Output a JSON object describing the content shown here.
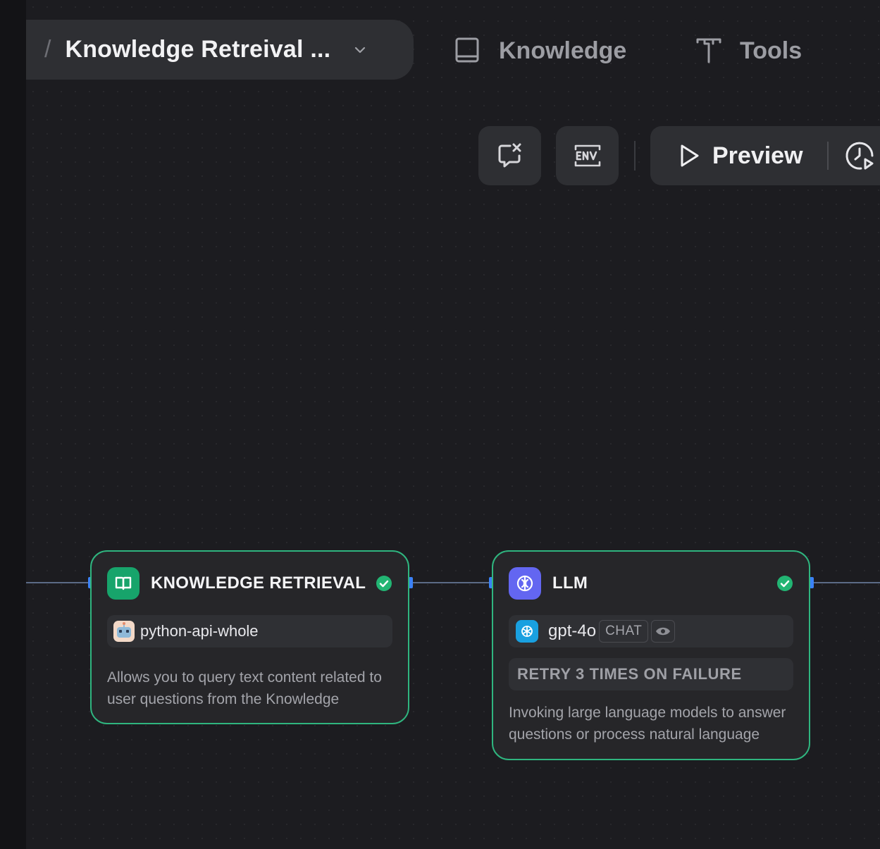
{
  "header": {
    "separator": "/",
    "app_title": "Knowledge Retreival ...",
    "nav": [
      {
        "label": "Knowledge",
        "icon": "book-icon"
      },
      {
        "label": "Tools",
        "icon": "tools-icon"
      }
    ]
  },
  "toolbar": {
    "buttons": [
      {
        "icon": "clear-conversation-icon"
      },
      {
        "icon": "env-icon"
      }
    ],
    "preview_label": "Preview",
    "history_icon": "run-history-icon"
  },
  "nodes": [
    {
      "id": "knowledge-retrieval",
      "title": "KNOWLEDGE RETRIEVAL",
      "icon": "book-open-icon",
      "icon_color": "#17a46b",
      "status": "success",
      "dataset": "python-api-whole",
      "description": "Allows you to query text content related to user questions from the Knowledge"
    },
    {
      "id": "llm",
      "title": "LLM",
      "icon": "llm-icon",
      "icon_color": "#6366f1",
      "status": "success",
      "model": "gpt-4o",
      "model_mode": "CHAT",
      "retry": "RETRY 3 TIMES ON FAILURE",
      "description": "Invoking large language models to answer questions or process natural language"
    }
  ],
  "colors": {
    "background": "#1c1c20",
    "panel": "#2e2f33",
    "node_border": "#2fb57f",
    "success": "#22b573",
    "handle": "#3b82f6"
  }
}
